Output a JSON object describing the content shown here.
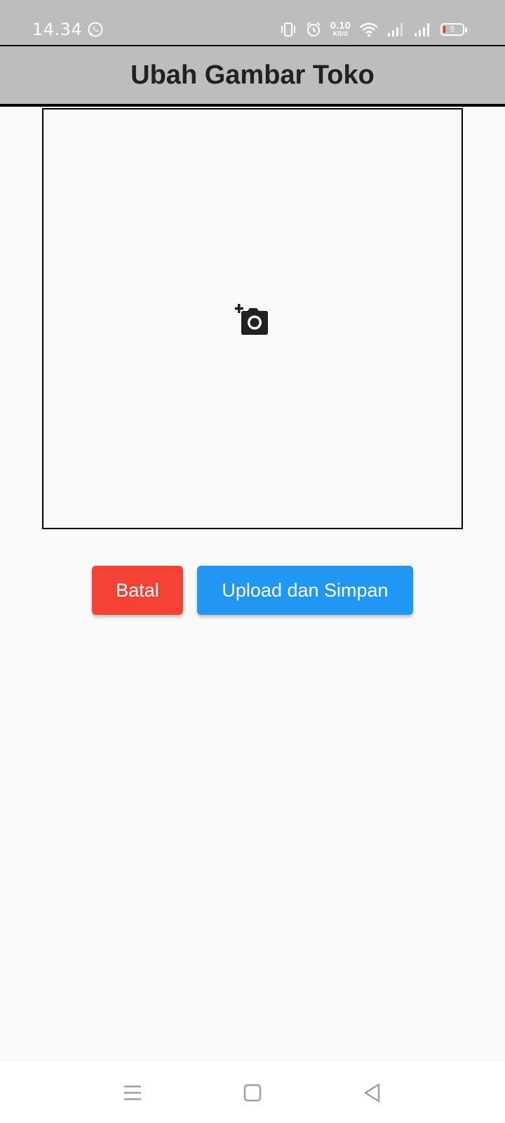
{
  "status_bar": {
    "time": "14.34",
    "net_speed_value": "0.10",
    "net_speed_unit": "KB/S",
    "battery_level": "5",
    "icons": [
      "whatsapp-icon",
      "vibrate-icon",
      "alarm-icon",
      "wifi-icon",
      "signal-icon",
      "signal-icon",
      "battery-icon"
    ]
  },
  "app_bar": {
    "title": "Ubah Gambar Toko"
  },
  "image_picker": {
    "icon": "add-a-photo-icon"
  },
  "actions": {
    "cancel_label": "Batal",
    "upload_label": "Upload dan Simpan"
  },
  "colors": {
    "app_bar_bg": "#bdbdbd",
    "cancel_button": "#f44336",
    "upload_button": "#2196f3",
    "background": "#f9f9f9"
  },
  "nav_bar": {
    "icons": [
      "menu-icon",
      "home-icon",
      "back-icon"
    ]
  }
}
